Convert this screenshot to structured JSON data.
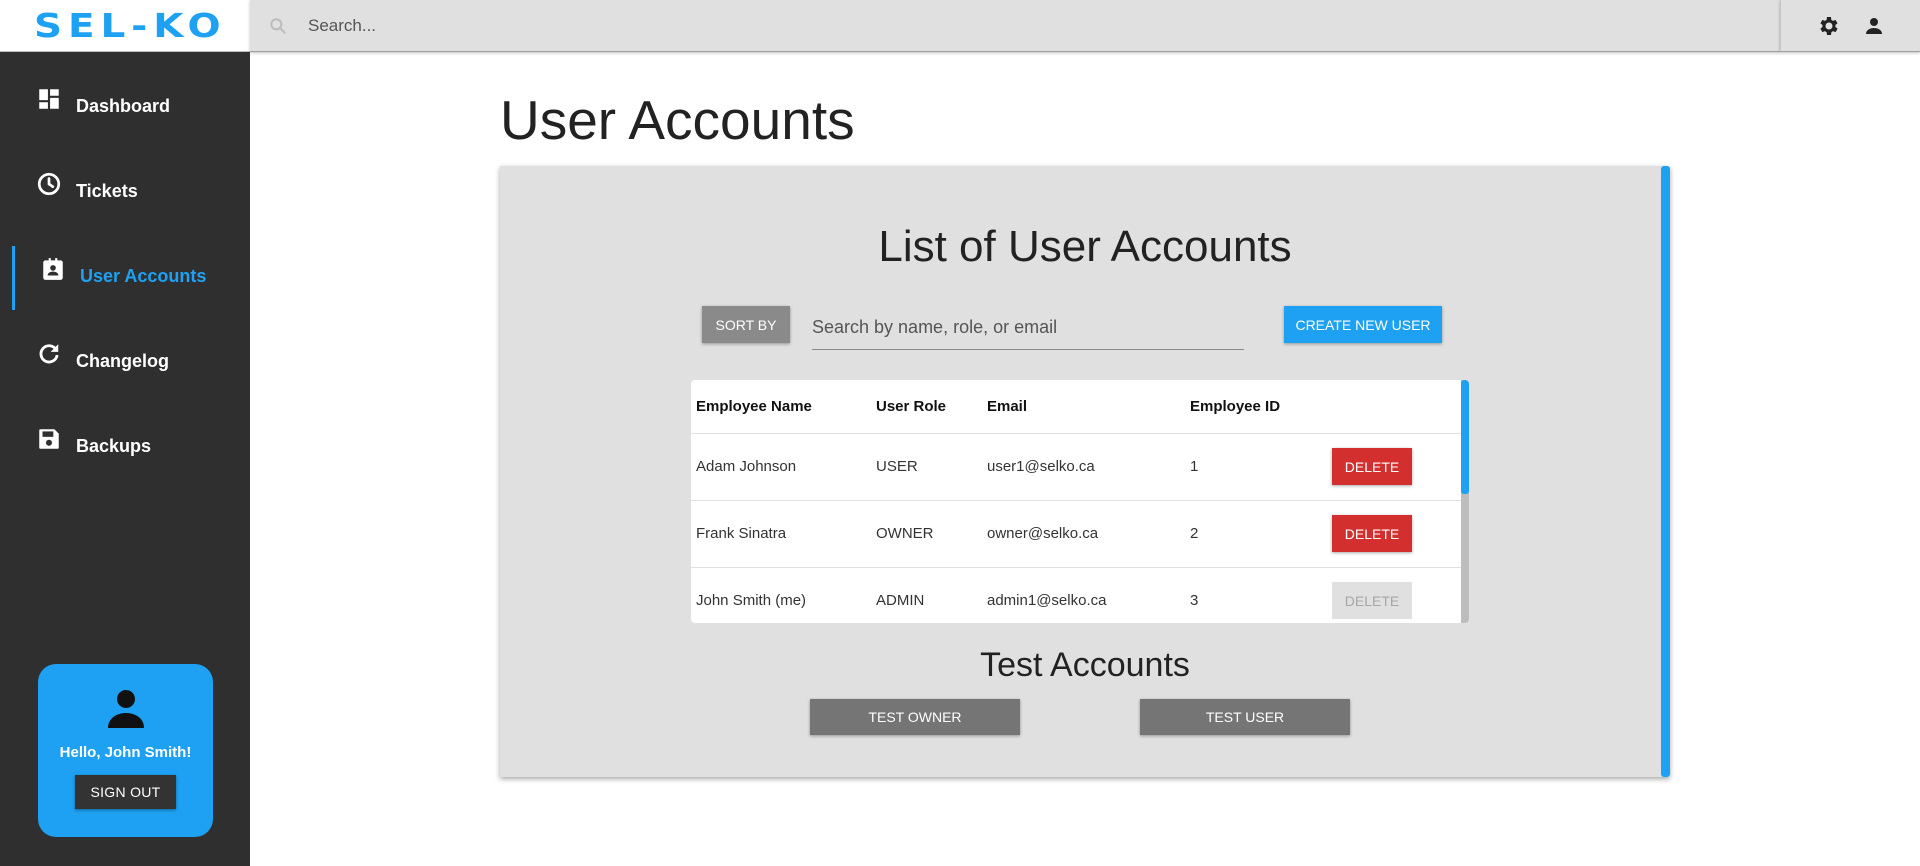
{
  "app": {
    "logo": "SEL-KO",
    "brand_color": "#1ea1f2"
  },
  "topbar": {
    "search_placeholder": "Search..."
  },
  "sidebar": {
    "items": [
      {
        "label": "Dashboard",
        "icon": "dashboard-icon"
      },
      {
        "label": "Tickets",
        "icon": "clock-icon"
      },
      {
        "label": "User Accounts",
        "icon": "badge-icon",
        "active": true
      },
      {
        "label": "Changelog",
        "icon": "refresh-icon"
      },
      {
        "label": "Backups",
        "icon": "save-icon"
      }
    ],
    "user_card": {
      "greeting": "Hello, John Smith!",
      "signout_label": "SIGN OUT"
    }
  },
  "main": {
    "title": "User Accounts",
    "panel": {
      "list_title": "List of User Accounts",
      "sort_label": "SORT BY",
      "filter_placeholder": "Search by name, role, or email",
      "create_label": "CREATE NEW USER",
      "table": {
        "headers": [
          "Employee Name",
          "User Role",
          "Email",
          "Employee ID"
        ],
        "rows": [
          {
            "name": "Adam Johnson",
            "role": "USER",
            "email": "user1@selko.ca",
            "id": "1",
            "action": "DELETE",
            "enabled": true
          },
          {
            "name": "Frank Sinatra",
            "role": "OWNER",
            "email": "owner@selko.ca",
            "id": "2",
            "action": "DELETE",
            "enabled": true
          },
          {
            "name": "John Smith (me)",
            "role": "ADMIN",
            "email": "admin1@selko.ca",
            "id": "3",
            "action": "DELETE",
            "enabled": false
          }
        ]
      },
      "test_title": "Test Accounts",
      "test_owner_label": "TEST OWNER",
      "test_user_label": "TEST USER"
    }
  },
  "colors": {
    "delete": "#d32f2f",
    "sidebar_bg": "#2f2f2f",
    "panel_bg": "#e0e0e0"
  }
}
